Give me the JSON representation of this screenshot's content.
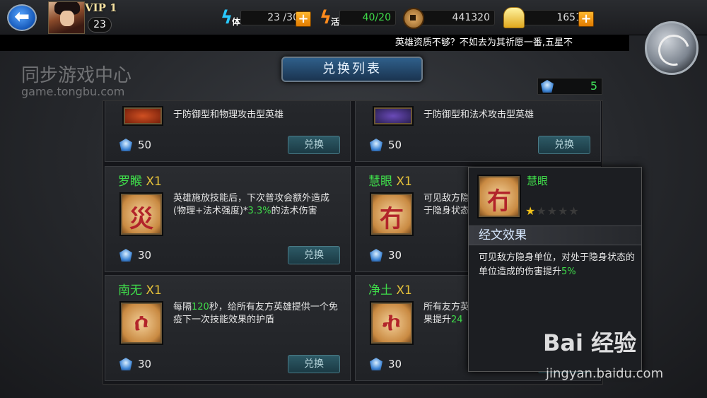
{
  "header": {
    "back_icon": "back-arrow-icon",
    "vip": "VIP 1",
    "level": "23",
    "stamina": {
      "icon_label": "体",
      "value": "23 /30"
    },
    "energy": {
      "icon_label": "活",
      "value": "40/20"
    },
    "coins": "441320",
    "gold": "1651"
  },
  "ticker": "英雄资质不够？不如去为其祈愿一番,五星不",
  "title": "兑换列表",
  "watermark": {
    "line1": "同步游戏中心",
    "line2": "game.tongbu.com"
  },
  "currency_count": "5",
  "cards": [
    {
      "name": "",
      "qty": "",
      "desc": "于防御型和物理攻击型英雄",
      "cost": "50",
      "button": "兑换",
      "glyph": "卍"
    },
    {
      "name": "",
      "qty": "",
      "desc": "于防御型和法术攻击型英雄",
      "cost": "50",
      "button": "兑换",
      "glyph": "✹"
    },
    {
      "name": "罗睺",
      "qty": "X1",
      "desc_pre": "英雄施放技能后，下次普攻会额外造成(物理+法术强度)*",
      "desc_hl": "3.3%",
      "desc_post": "的法术伤害",
      "cost": "30",
      "button": "兑换",
      "glyph": "災"
    },
    {
      "name": "慧眼",
      "qty": "X1",
      "desc": "可见敌方隐身单位，对处于隐身状态的单位造成",
      "cost": "30",
      "button": "兑换",
      "glyph": "冇"
    },
    {
      "name": "南无",
      "qty": "X1",
      "desc_pre": "每隔",
      "desc_hl": "120",
      "desc_post": "秒，给所有友方英雄提供一个免疫下一次技能效果的护盾",
      "cost": "30",
      "button": "兑换",
      "glyph": "ሶ"
    },
    {
      "name": "净土",
      "qty": "X1",
      "desc_pre": "所有友方英",
      "desc_hl": "24",
      "desc_post": "",
      "desc_line2_pre": "果提升",
      "cost": "30",
      "button": "兑换",
      "glyph": "ኯ"
    }
  ],
  "popup": {
    "name": "慧眼",
    "stars_on": 1,
    "stars_total": 5,
    "section": "经文效果",
    "desc_pre": "可见敌方隐身单位，对处于隐身状态的单位造成的伤害提升",
    "desc_hl": "5%"
  },
  "baidu": {
    "logo": "Bai 经验",
    "url": "jingyan.baidu.com"
  },
  "colors": {
    "accent_green": "#3fdc4a",
    "qty_yellow": "#e6c23a",
    "plus_orange": "#ffb62e"
  }
}
